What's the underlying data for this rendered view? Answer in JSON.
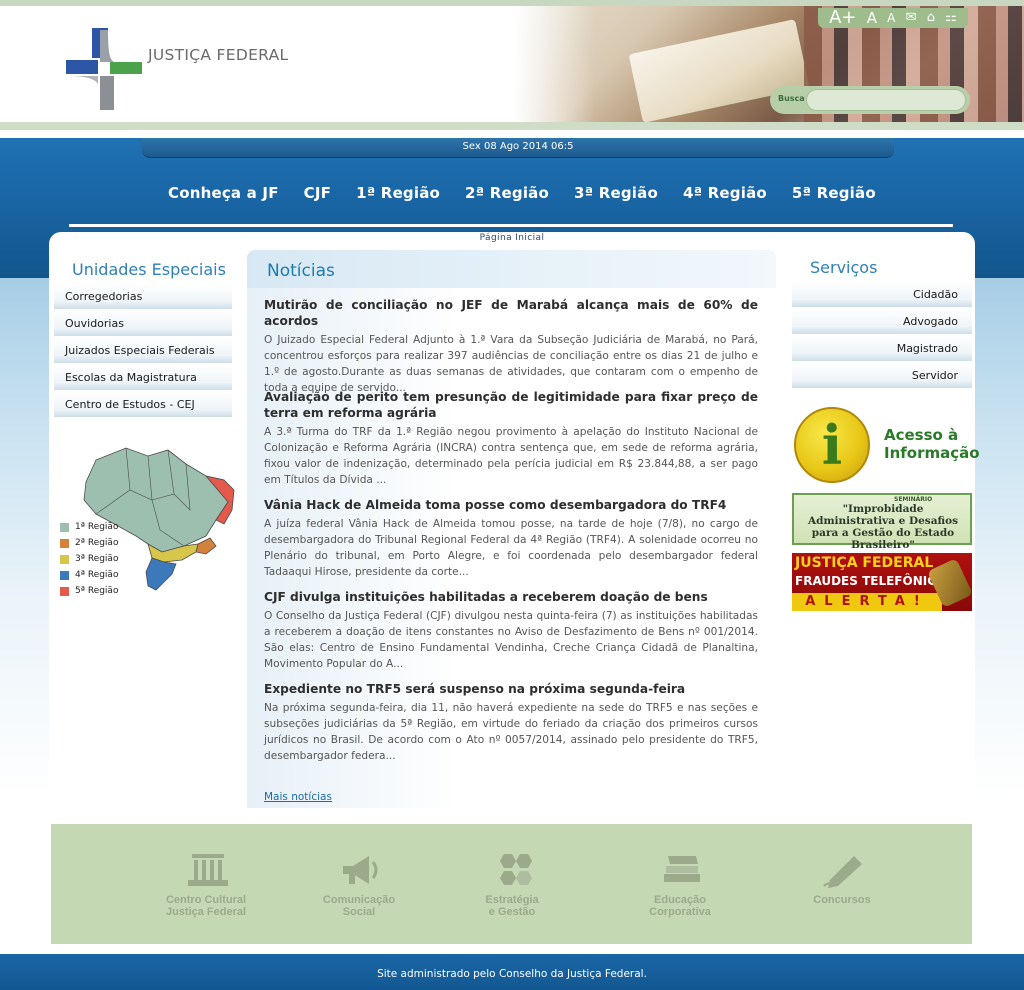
{
  "header": {
    "logo_text": "JUSTIÇA FEDERAL",
    "tools": [
      "A+",
      "A",
      "A",
      "mail-icon",
      "home-icon",
      "sitemap-icon"
    ],
    "search_label": "Busca",
    "search_value": ""
  },
  "date_text": "Sex 08 Ago 2014 06:5",
  "nav": {
    "items": [
      "Conheça a JF",
      "CJF",
      "1ª Região",
      "2ª Região",
      "3ª Região",
      "4ª Região",
      "5ª Região"
    ]
  },
  "breadcrumb": "Página Inicial",
  "left": {
    "title": "Unidades Especiais",
    "items": [
      "Corregedorias",
      "Ouvidorias",
      "Juizados Especiais Federais",
      "Escolas da Magistratura",
      "Centro de Estudos - CEJ"
    ],
    "legend": [
      {
        "label": "1ª Região",
        "color": "#9dbfb0"
      },
      {
        "label": "2ª Região",
        "color": "#d2823a"
      },
      {
        "label": "3ª Região",
        "color": "#d7c64a"
      },
      {
        "label": "4ª Região",
        "color": "#3b79bb"
      },
      {
        "label": "5ª Região",
        "color": "#e35a4c"
      }
    ]
  },
  "news": {
    "title": "Notícias",
    "items": [
      {
        "headline": "Mutirão de conciliação no JEF de Marabá alcança mais de 60% de acordos",
        "text": "O Juizado Especial Federal Adjunto à 1.ª Vara da Subseção Judiciária de Marabá, no Pará, concentrou esforços para realizar 397 audiências de conciliação entre os dias 21 de julho e 1.º de agosto.Durante as duas semanas de atividades, que contaram com o empenho de toda a equipe de servido..."
      },
      {
        "headline": "Avaliação de perito tem presunção de legitimidade para fixar preço de terra em reforma agrária",
        "text": "A 3.ª Turma do TRF da 1.ª Região negou provimento à apelação do Instituto Nacional de Colonização e Reforma Agrária (INCRA) contra sentença que, em sede de reforma agrária, fixou valor de indenização, determinado pela perícia judicial em R$ 23.844,88, a ser pago em Títulos da Dívida ..."
      },
      {
        "headline": "Vânia Hack de Almeida toma posse como desembargadora do TRF4",
        "text": "A juíza federal Vânia Hack de Almeida tomou posse, na tarde de hoje (7/8), no cargo de desembargadora do Tribunal Regional Federal da 4ª Região (TRF4). A solenidade ocorreu no Plenário do tribunal, em Porto Alegre, e foi coordenada pelo desembargador federal Tadaaqui Hirose, presidente da corte..."
      },
      {
        "headline": "CJF divulga instituições habilitadas a receberem doação de bens",
        "text": "O Conselho da Justiça Federal (CJF) divulgou nesta quinta-feira (7) as instituições habilitadas a receberem a doação de itens constantes no Aviso de Desfazimento de Bens nº 001/2014. São elas: Centro de Ensino Fundamental Vendinha, Creche Criança Cidadã de Planaltina, Movimento Popular do A..."
      },
      {
        "headline": "Expediente no TRF5 será suspenso na próxima segunda-feira",
        "text": "Na próxima segunda-feira, dia 11, não haverá expediente na sede do TRF5 e nas seções e subseções judiciárias da 5ª Região, em virtude do feriado da criação dos primeiros cursos jurídicos no Brasil. De acordo com o Ato nº 0057/2014, assinado pelo presidente do TRF5, desembargador federa..."
      }
    ],
    "more": "Mais notícias"
  },
  "right": {
    "title": "Serviços",
    "items": [
      "Cidadão",
      "Advogado",
      "Magistrado",
      "Servidor"
    ],
    "banner_info_line1": "Acesso à",
    "banner_info_line2": "Informação",
    "banner_info_icon": "i",
    "banner_improb_small": "SEMINÁRIO",
    "banner_improb": "\"Improbidade Administrativa e Desafios para a Gestão do Estado Brasileiro\"",
    "banner_fraud_l1": "JUSTIÇA FEDERAL",
    "banner_fraud_l2": "FRAUDES TELEFÔNICAS",
    "banner_fraud_l3": "ALERTA!"
  },
  "footer_links": [
    {
      "label1": "Centro Cultural",
      "label2": "Justiça Federal",
      "icon": "building-icon"
    },
    {
      "label1": "Comunicação",
      "label2": "Social",
      "icon": "megaphone-icon"
    },
    {
      "label1": "Estratégia",
      "label2": "e Gestão",
      "icon": "hexagons-icon"
    },
    {
      "label1": "Educação",
      "label2": "Corporativa",
      "icon": "books-icon"
    },
    {
      "label1": "Concursos",
      "label2": "",
      "icon": "pencil-icon"
    }
  ],
  "footer_text": "Site administrado pelo Conselho da Justiça Federal."
}
